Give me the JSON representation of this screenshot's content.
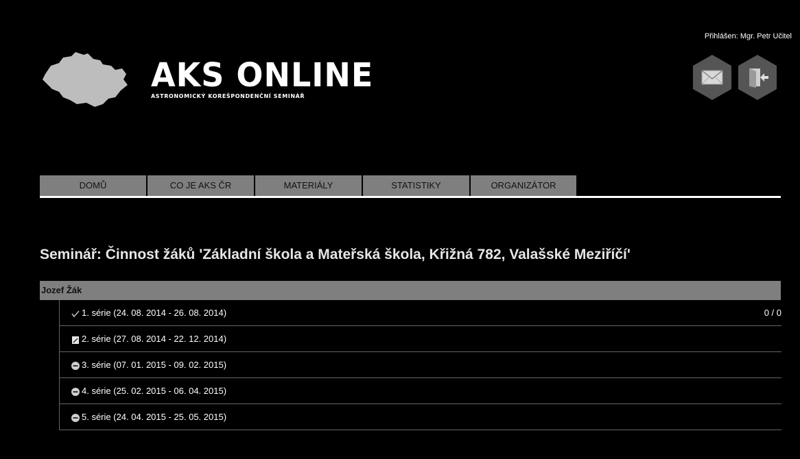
{
  "header": {
    "logo_title": "AKS ONLINE",
    "logo_subtitle": "ASTRONOMICKÝ KOREŠPONDENČNÍ SEMINÁŘ",
    "user_label": "Přihlášen: Mgr. Petr Učitel",
    "actions": [
      {
        "icon": "mail-icon"
      },
      {
        "icon": "logout-icon"
      }
    ]
  },
  "nav": {
    "items": [
      {
        "label": "DOMŮ"
      },
      {
        "label": "CO JE AKS ČR"
      },
      {
        "label": "MATERIÁLY"
      },
      {
        "label": "STATISTIKY"
      },
      {
        "label": "ORGANIZÁTOR"
      }
    ]
  },
  "main": {
    "title": "Seminář: Činnost žáků 'Základní škola a Mateřská škola, Křižná 782, Valašské Meziříčí'",
    "student": "Jozef Žák",
    "series": [
      {
        "label": "1. série (24. 08. 2014 - 26. 08. 2014)",
        "icon": "checkmark-icon",
        "score": "0 / 0"
      },
      {
        "label": "2. série (27. 08. 2014 - 22. 12. 2014)",
        "icon": "edit-icon",
        "score": ""
      },
      {
        "label": "3. série (07. 01. 2015 - 09. 02. 2015)",
        "icon": "minus-circle-icon",
        "score": ""
      },
      {
        "label": "4. série (25. 02. 2015 - 06. 04. 2015)",
        "icon": "minus-circle-icon",
        "score": ""
      },
      {
        "label": "5. série (24. 04. 2015 - 25. 05. 2015)",
        "icon": "minus-circle-icon",
        "score": ""
      }
    ]
  },
  "colors": {
    "background": "#000000",
    "nav_bg": "#7f7f7f",
    "hex_button": "#555555"
  }
}
